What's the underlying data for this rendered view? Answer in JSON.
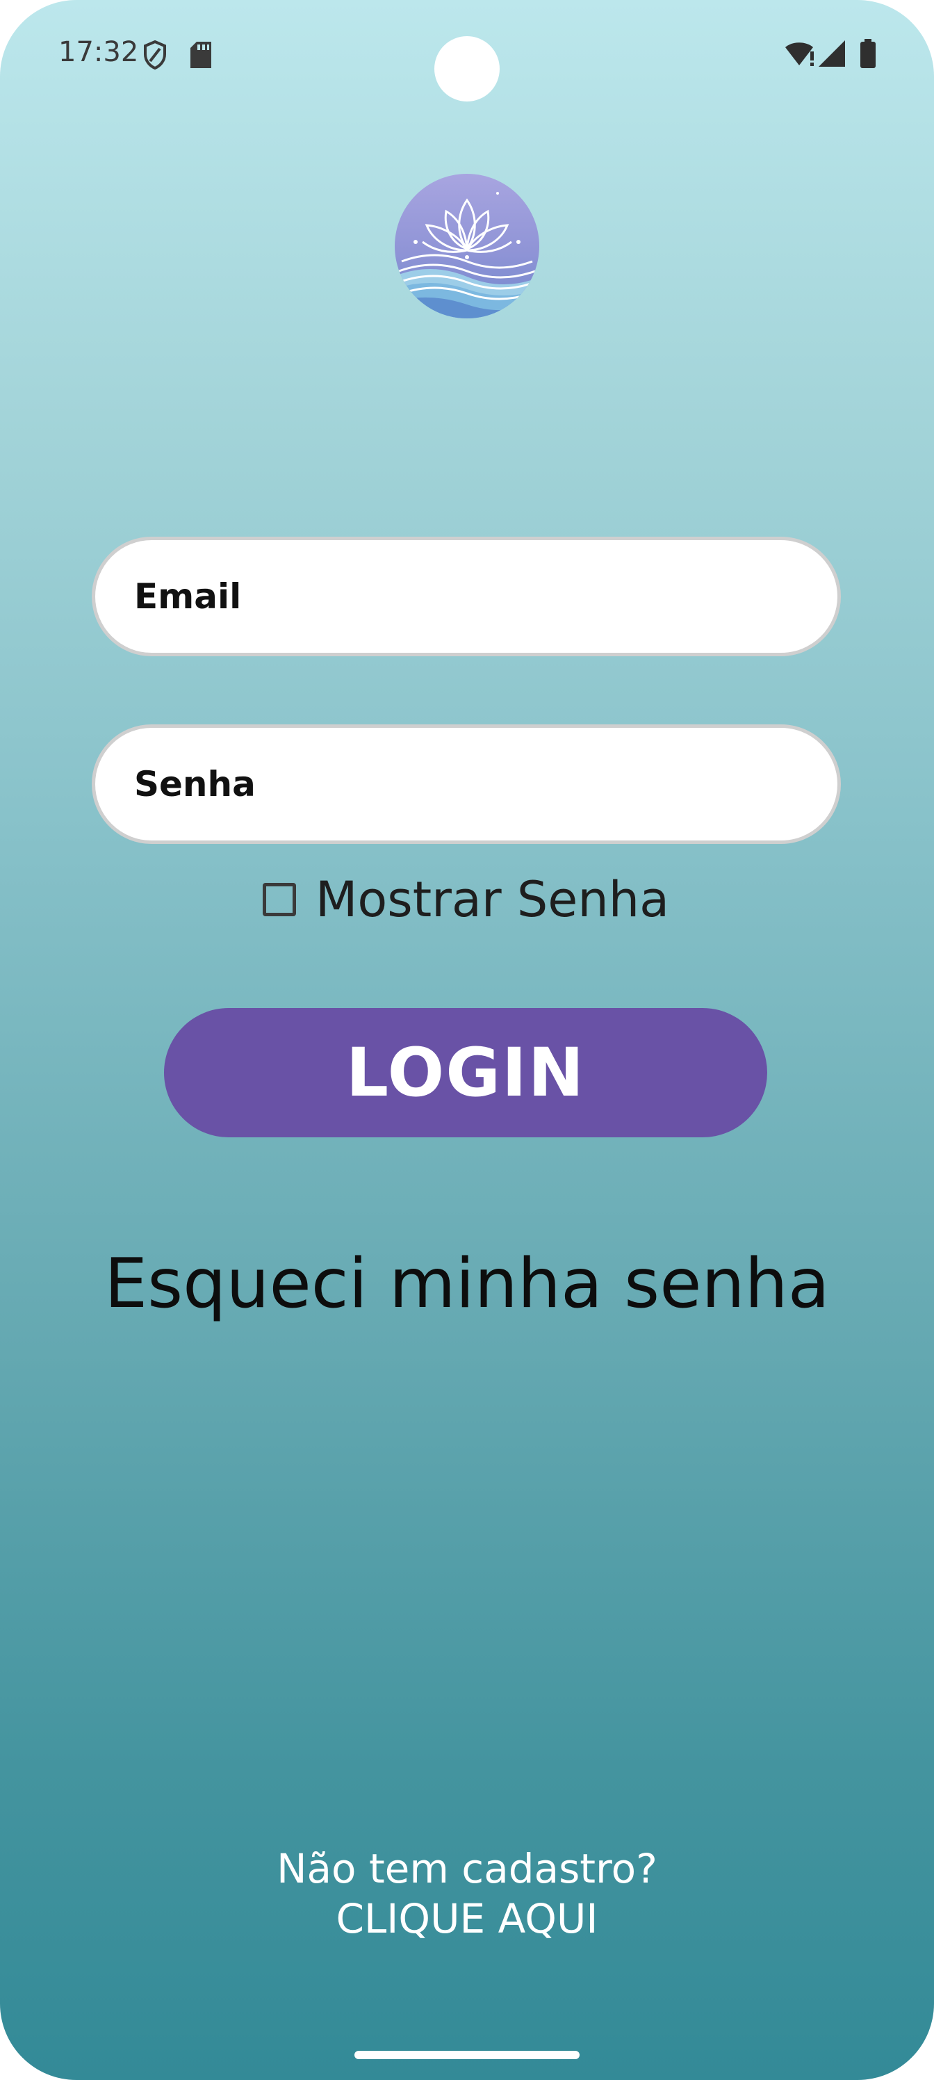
{
  "status_bar": {
    "time": "17:32",
    "left_icons": [
      "shield-icon",
      "sd-card-icon"
    ],
    "right_icons": [
      "wifi-icon",
      "signal-icon",
      "battery-icon"
    ]
  },
  "logo": {
    "icon": "lotus-waves-logo"
  },
  "login_form": {
    "email_placeholder": "Email",
    "password_placeholder": "Senha",
    "show_password_label": "Mostrar Senha",
    "show_password_checked": false,
    "login_button_label": "LOGIN",
    "forgot_password_label": "Esqueci minha senha"
  },
  "signup": {
    "prompt": "Não tem cadastro?",
    "link_label": "CLIQUE AQUI"
  },
  "colors": {
    "background_top": "#bce7ec",
    "background_bottom": "#338a97",
    "accent": "#6952a6",
    "field_background": "#ffffff"
  }
}
